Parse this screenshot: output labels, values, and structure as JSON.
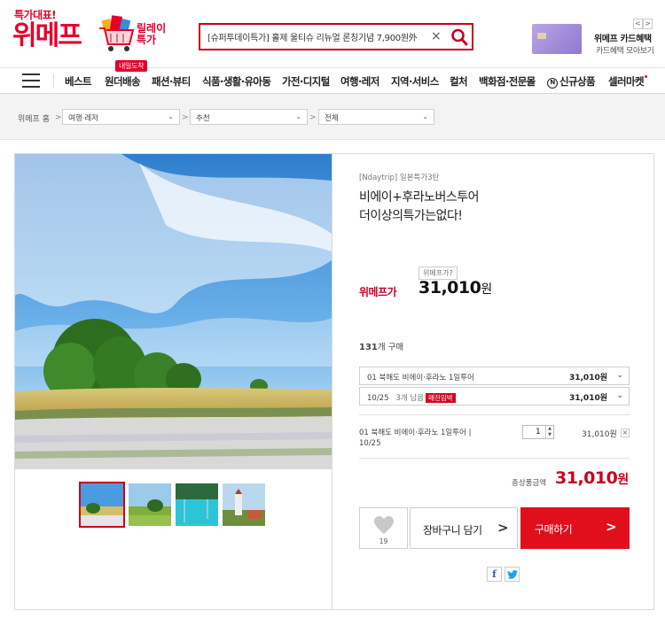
{
  "header": {
    "logo_tag": "특가대표!",
    "logo_main": "위메프",
    "promo_line1": "릴레이",
    "promo_line2": "특가",
    "search_value": "[슈퍼투데이특가] 홀제 울티슈 리뉴얼 론칭기념 7,900원外",
    "clear_glyph": "×",
    "card_title": "위메프 카드혜택",
    "card_sub": "카드혜택 모아보기",
    "prev": "<",
    "next": ">"
  },
  "nav": {
    "items": [
      "베스트",
      "원더배송",
      "패션·뷰티",
      "식품·생활·유아동",
      "가전·디지털",
      "여행·레저",
      "지역·서비스",
      "컬처",
      "백화점·전문몰",
      "신규상품",
      "셀러마켓"
    ],
    "badge": "내일도착",
    "new_mark": "N"
  },
  "breadcrumb": {
    "home": "위메프 홈",
    "sep": ">",
    "levels": [
      "여행·레저",
      "추천",
      "전체"
    ],
    "dropdown_glyph": "⌄"
  },
  "product": {
    "brand": "[Ndaytrip] 일본특가3탄",
    "title_line1": "비에이+후라노버스투어",
    "title_line2": "더이상의특가는없다!",
    "price_tip": "위메프가?",
    "price_label": "위메프가",
    "price": "31,010",
    "price_unit": "원",
    "sold_count": "131",
    "sold_suffix": "개 구매",
    "option1": {
      "label": "01 북해도 비에이·후라노 1일투어",
      "price": "31,010원"
    },
    "option2": {
      "label": "10/25",
      "stock": "3개 남음",
      "badge": "매진임박",
      "price": "31,010원"
    },
    "selected": {
      "name": "01 북해도 비에이·후라노 1일투어 |",
      "date": "10/25",
      "qty": "1",
      "price": "31,010원",
      "remove": "×"
    },
    "total_label": "총상품금액",
    "total": "31,010",
    "total_unit": "원",
    "likes": "19",
    "cart_label": "장바구니 담기",
    "buy_label": "구매하기",
    "chevron": ">",
    "share_fb": "f"
  },
  "colors": {
    "brand_red": "#e4002b",
    "buy_red": "#e10f1c",
    "sky": "#3f8fd4",
    "field": "#c9b061"
  }
}
